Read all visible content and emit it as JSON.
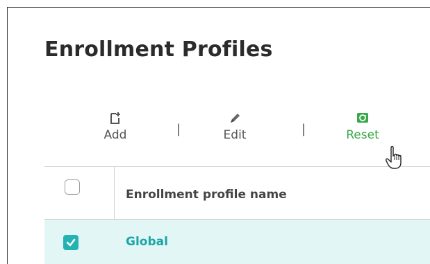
{
  "page": {
    "title": "Enrollment Profiles"
  },
  "toolbar": {
    "add_label": "Add",
    "edit_label": "Edit",
    "reset_label": "Reset",
    "separator": "|",
    "reset_color": "#3aa84a"
  },
  "table": {
    "columns": [
      "Enrollment profile name"
    ],
    "rows": [
      {
        "name": "Global",
        "selected": true
      }
    ]
  },
  "colors": {
    "accent": "#23b3b3",
    "row_highlight": "#e3f6f6"
  },
  "icons": [
    "add-document-icon",
    "pencil-icon",
    "reset-icon",
    "checkmark-icon",
    "hand-pointer-icon"
  ]
}
